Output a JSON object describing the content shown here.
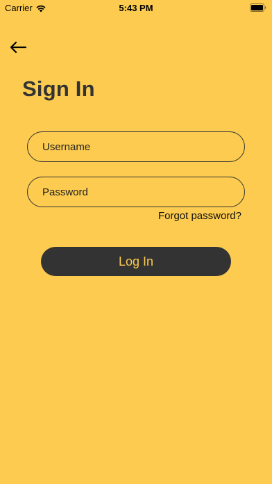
{
  "status_bar": {
    "carrier": "Carrier",
    "time": "5:43 PM"
  },
  "header": {
    "back_icon": "arrow-left-icon"
  },
  "title": "Sign In",
  "form": {
    "username_placeholder": "Username",
    "password_placeholder": "Password",
    "forgot_password": "Forgot password?",
    "login_label": "Log In"
  },
  "colors": {
    "background": "#FCCB4F",
    "button": "#333333",
    "button_text": "#FCCB4F"
  }
}
